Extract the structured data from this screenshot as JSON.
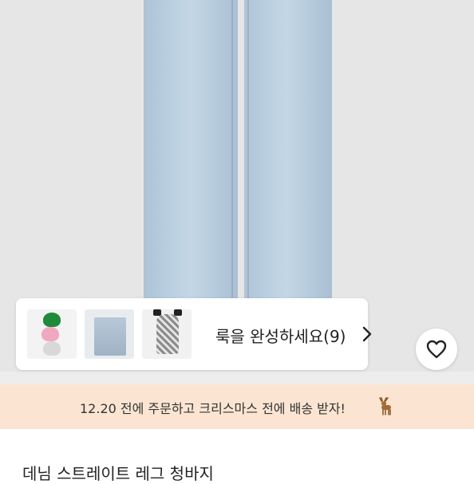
{
  "look": {
    "cta_label": "룩을 완성하세요(9)"
  },
  "banner": {
    "text": "12.20 전에 주문하고 크리스마스 전에 배송 받자!"
  },
  "product": {
    "title": "데님 스트레이트 레그 청바지"
  },
  "icons": {
    "chevron": "chevron-right-icon",
    "wishlist": "heart-icon",
    "deer": "deer-icon"
  },
  "colors": {
    "banner_bg": "#fbe5d2",
    "denim": "#b9cfe0"
  }
}
